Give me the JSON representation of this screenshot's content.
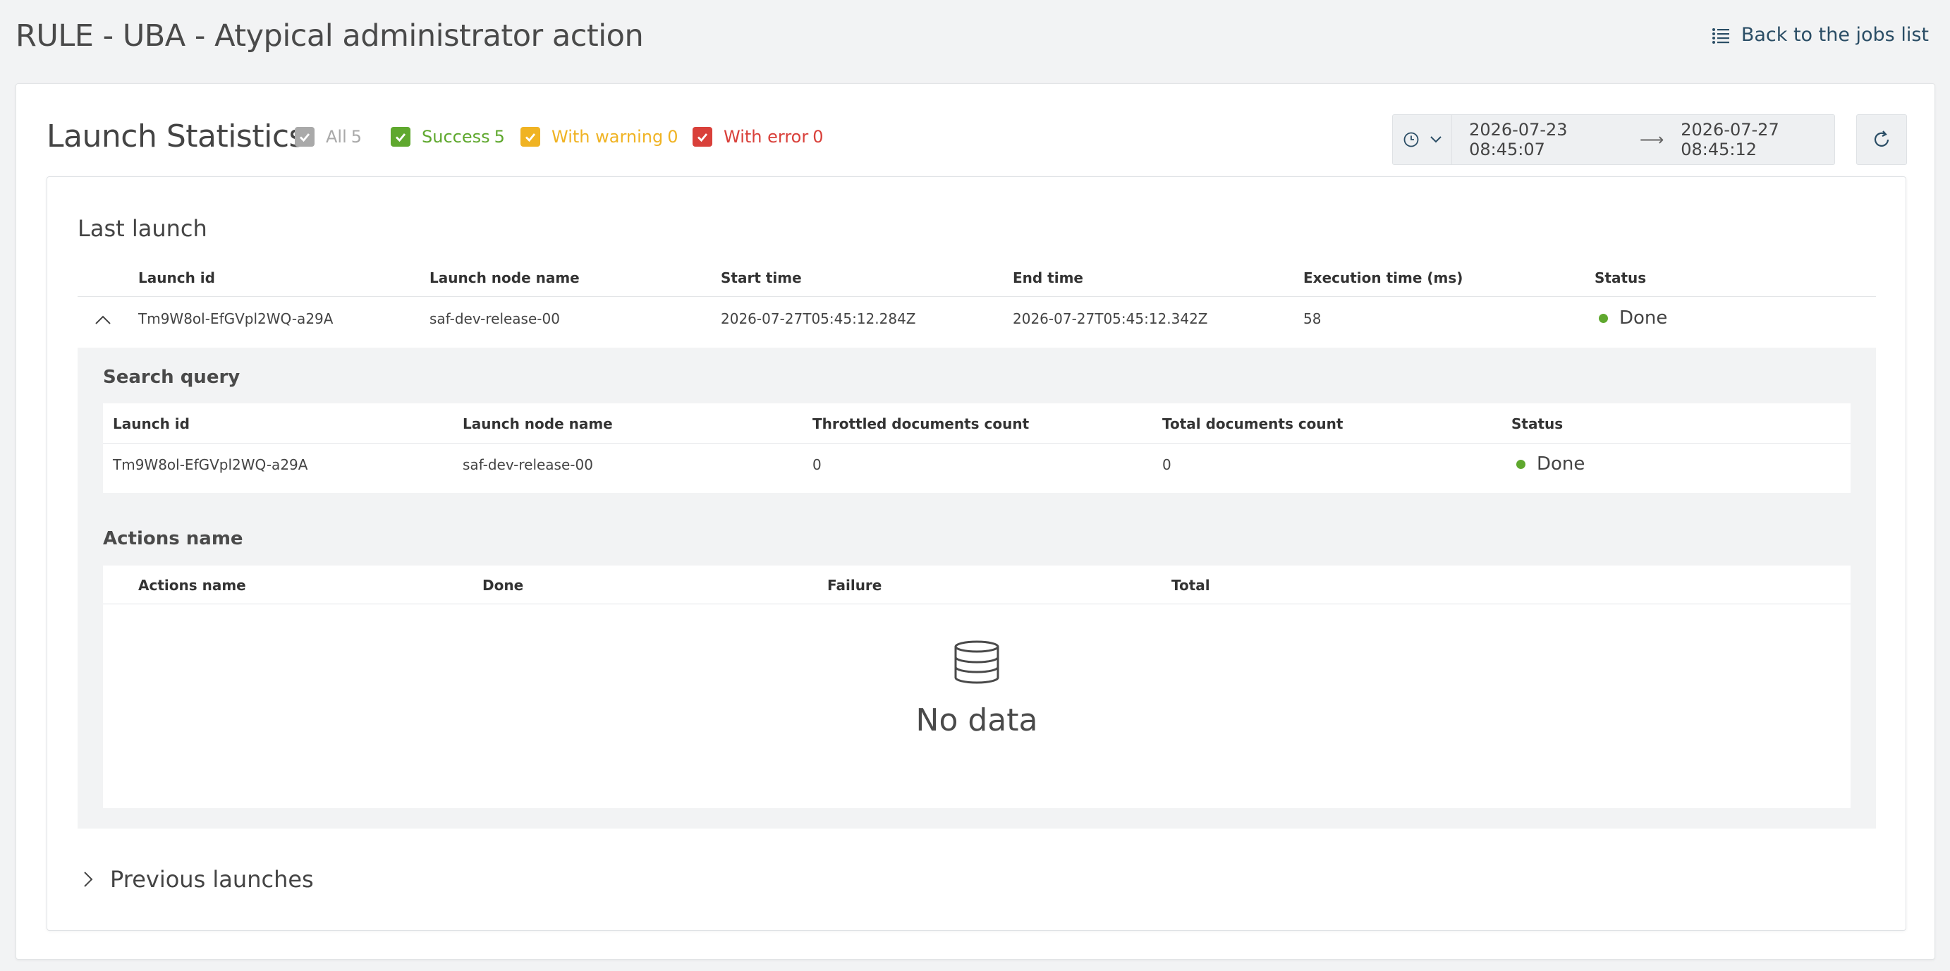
{
  "page": {
    "title": "RULE - UBA - Atypical administrator action",
    "back_link": "Back to the jobs list"
  },
  "stats": {
    "title": "Launch Statistics",
    "filters": [
      {
        "label": "All",
        "count": "5",
        "color": "#a9a9a9"
      },
      {
        "label": "Success",
        "count": "5",
        "color": "#5fa82e"
      },
      {
        "label": "With warning",
        "count": "0",
        "color": "#f0b323"
      },
      {
        "label": "With error",
        "count": "0",
        "color": "#d9403a"
      }
    ],
    "date_from": "2026-07-23 08:45:07",
    "date_arrow": "⟶",
    "date_to": "2026-07-27 08:45:12"
  },
  "last_launch": {
    "title": "Last launch",
    "headers": [
      "Launch id",
      "Launch node name",
      "Start time",
      "End time",
      "Execution time (ms)",
      "Status"
    ],
    "row": {
      "launch_id": "Tm9W8ol-EfGVpl2WQ-a29A",
      "node": "saf-dev-release-00",
      "start": "2026-07-27T05:45:12.284Z",
      "end": "2026-07-27T05:45:12.342Z",
      "exec_ms": "58",
      "status": "Done"
    }
  },
  "search_query": {
    "title": "Search query",
    "headers": [
      "Launch id",
      "Launch node name",
      "Throttled documents count",
      "Total documents count",
      "Status"
    ],
    "row": {
      "launch_id": "Tm9W8ol-EfGVpl2WQ-a29A",
      "node": "saf-dev-release-00",
      "throttled": "0",
      "total": "0",
      "status": "Done"
    }
  },
  "actions": {
    "title": "Actions name",
    "headers": [
      "Actions name",
      "Done",
      "Failure",
      "Total"
    ],
    "empty_text": "No data"
  },
  "previous": {
    "label": "Previous launches"
  },
  "colors": {
    "status_done": "#5fa82e",
    "link": "#2a4d65"
  }
}
